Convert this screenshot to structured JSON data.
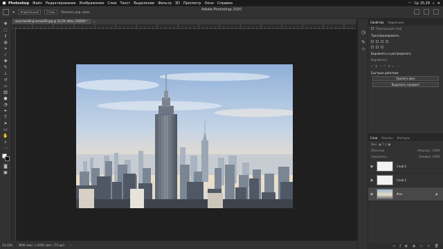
{
  "menubar": {
    "app_name": "Photoshop",
    "items": [
      "Файл",
      "Редактирование",
      "Изображение",
      "Слои",
      "Текст",
      "Выделение",
      "Фильтр",
      "3D",
      "Просмотр",
      "Окно",
      "Справка"
    ],
    "clock": "Ср 15:29"
  },
  "options": {
    "window_title": "Adobe Photoshop 2020",
    "mode_label": "Нормальный",
    "style_label": "Стиль",
    "show_label": "Показать упр. элем."
  },
  "document": {
    "tab_label": "warp-building-lesson00.jpg @ 33,3% (Фон, RGB/8) *"
  },
  "status": {
    "zoom": "33,33%",
    "doc_info": "3600 пикс. x 2400 пикс. (72 ppi)"
  },
  "properties": {
    "tabs": [
      "Свойства",
      "Коррекция"
    ],
    "pixel_layer": "Пиксельный слой",
    "transform_header": "Трансформировать",
    "align_header": "Выровнять и распределить",
    "align_sub": "Выровнять:",
    "quick_header": "Быстрые действия",
    "quick_buttons": [
      "Удалить фон",
      "Выделить предмет"
    ]
  },
  "layers": {
    "tabs": [
      "Слои",
      "Каналы",
      "Контуры"
    ],
    "kind": "Вид",
    "blend": "Обычные",
    "opacity": "Непрозр.: 100%",
    "lock": "Закрепить:",
    "fill": "Заливка: 100%",
    "items": [
      {
        "name": "Слой 2"
      },
      {
        "name": "Слой 1"
      },
      {
        "name": "Фон"
      }
    ]
  },
  "colors": {
    "accent": "#2f7fd0",
    "sky_top": "#8fb0d9",
    "sky_bottom": "#f0dfc5"
  },
  "icons": [
    "apple-icon",
    "home-icon",
    "eye-icon",
    "lock-icon",
    "move-tool-icon",
    "marquee-tool-icon",
    "lasso-tool-icon",
    "crop-tool-icon",
    "brush-tool-icon",
    "text-tool-icon",
    "hand-tool-icon",
    "zoom-tool-icon"
  ]
}
